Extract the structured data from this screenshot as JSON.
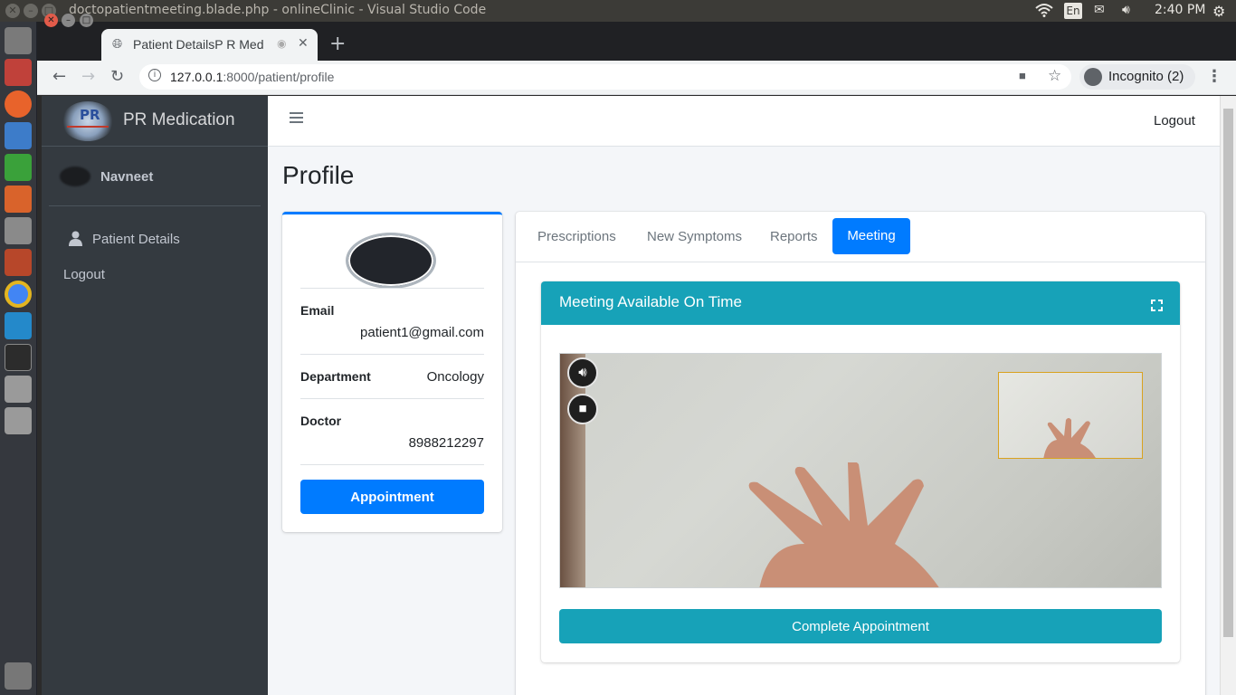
{
  "os": {
    "window_title": "doctopatientmeeting.blade.php - onlineClinic - Visual Studio Code",
    "keyboard": "En",
    "clock": "2:40 PM"
  },
  "browser": {
    "tab_title": "Patient DetailsP R Med",
    "url_host": "127.0.0.1",
    "url_rest": ":8000/patient/profile",
    "profile_label": "Incognito (2)"
  },
  "app": {
    "brand": "PR Medication",
    "logo_text": "PR",
    "user_name": "Navneet",
    "nav_items": [
      {
        "label": "Patient Details",
        "icon": "user-icon"
      },
      {
        "label": "Logout"
      }
    ],
    "top_logout": "Logout"
  },
  "page": {
    "title": "Profile"
  },
  "profile": {
    "email_label": "Email",
    "email": "patient1@gmail.com",
    "department_label": "Department",
    "department": "Oncology",
    "doctor_label": "Doctor",
    "doctor": "8988212297",
    "appointment_button": "Appointment"
  },
  "tabs": [
    {
      "label": "Prescriptions",
      "active": false
    },
    {
      "label": "New Symptoms",
      "active": false
    },
    {
      "label": "Reports",
      "active": false
    },
    {
      "label": "Meeting",
      "active": true
    }
  ],
  "meeting": {
    "header": "Meeting Available On Time",
    "complete_button": "Complete Appointment"
  },
  "colors": {
    "primary": "#007bff",
    "info": "#17a2b8",
    "sidebar": "#343a40"
  }
}
